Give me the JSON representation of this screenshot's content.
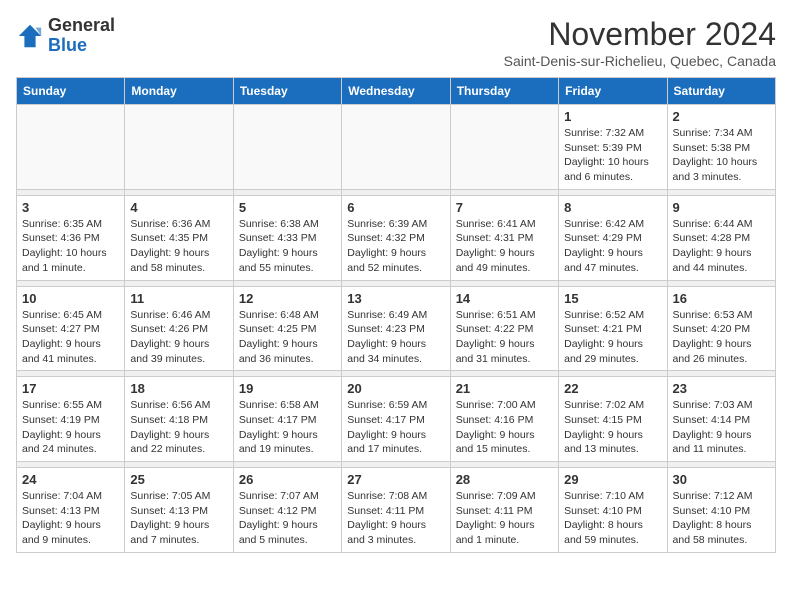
{
  "logo": {
    "general": "General",
    "blue": "Blue"
  },
  "header": {
    "month": "November 2024",
    "location": "Saint-Denis-sur-Richelieu, Quebec, Canada"
  },
  "weekdays": [
    "Sunday",
    "Monday",
    "Tuesday",
    "Wednesday",
    "Thursday",
    "Friday",
    "Saturday"
  ],
  "weeks": [
    [
      {
        "day": "",
        "info": ""
      },
      {
        "day": "",
        "info": ""
      },
      {
        "day": "",
        "info": ""
      },
      {
        "day": "",
        "info": ""
      },
      {
        "day": "",
        "info": ""
      },
      {
        "day": "1",
        "info": "Sunrise: 7:32 AM\nSunset: 5:39 PM\nDaylight: 10 hours and 6 minutes."
      },
      {
        "day": "2",
        "info": "Sunrise: 7:34 AM\nSunset: 5:38 PM\nDaylight: 10 hours and 3 minutes."
      }
    ],
    [
      {
        "day": "3",
        "info": "Sunrise: 6:35 AM\nSunset: 4:36 PM\nDaylight: 10 hours and 1 minute."
      },
      {
        "day": "4",
        "info": "Sunrise: 6:36 AM\nSunset: 4:35 PM\nDaylight: 9 hours and 58 minutes."
      },
      {
        "day": "5",
        "info": "Sunrise: 6:38 AM\nSunset: 4:33 PM\nDaylight: 9 hours and 55 minutes."
      },
      {
        "day": "6",
        "info": "Sunrise: 6:39 AM\nSunset: 4:32 PM\nDaylight: 9 hours and 52 minutes."
      },
      {
        "day": "7",
        "info": "Sunrise: 6:41 AM\nSunset: 4:31 PM\nDaylight: 9 hours and 49 minutes."
      },
      {
        "day": "8",
        "info": "Sunrise: 6:42 AM\nSunset: 4:29 PM\nDaylight: 9 hours and 47 minutes."
      },
      {
        "day": "9",
        "info": "Sunrise: 6:44 AM\nSunset: 4:28 PM\nDaylight: 9 hours and 44 minutes."
      }
    ],
    [
      {
        "day": "10",
        "info": "Sunrise: 6:45 AM\nSunset: 4:27 PM\nDaylight: 9 hours and 41 minutes."
      },
      {
        "day": "11",
        "info": "Sunrise: 6:46 AM\nSunset: 4:26 PM\nDaylight: 9 hours and 39 minutes."
      },
      {
        "day": "12",
        "info": "Sunrise: 6:48 AM\nSunset: 4:25 PM\nDaylight: 9 hours and 36 minutes."
      },
      {
        "day": "13",
        "info": "Sunrise: 6:49 AM\nSunset: 4:23 PM\nDaylight: 9 hours and 34 minutes."
      },
      {
        "day": "14",
        "info": "Sunrise: 6:51 AM\nSunset: 4:22 PM\nDaylight: 9 hours and 31 minutes."
      },
      {
        "day": "15",
        "info": "Sunrise: 6:52 AM\nSunset: 4:21 PM\nDaylight: 9 hours and 29 minutes."
      },
      {
        "day": "16",
        "info": "Sunrise: 6:53 AM\nSunset: 4:20 PM\nDaylight: 9 hours and 26 minutes."
      }
    ],
    [
      {
        "day": "17",
        "info": "Sunrise: 6:55 AM\nSunset: 4:19 PM\nDaylight: 9 hours and 24 minutes."
      },
      {
        "day": "18",
        "info": "Sunrise: 6:56 AM\nSunset: 4:18 PM\nDaylight: 9 hours and 22 minutes."
      },
      {
        "day": "19",
        "info": "Sunrise: 6:58 AM\nSunset: 4:17 PM\nDaylight: 9 hours and 19 minutes."
      },
      {
        "day": "20",
        "info": "Sunrise: 6:59 AM\nSunset: 4:17 PM\nDaylight: 9 hours and 17 minutes."
      },
      {
        "day": "21",
        "info": "Sunrise: 7:00 AM\nSunset: 4:16 PM\nDaylight: 9 hours and 15 minutes."
      },
      {
        "day": "22",
        "info": "Sunrise: 7:02 AM\nSunset: 4:15 PM\nDaylight: 9 hours and 13 minutes."
      },
      {
        "day": "23",
        "info": "Sunrise: 7:03 AM\nSunset: 4:14 PM\nDaylight: 9 hours and 11 minutes."
      }
    ],
    [
      {
        "day": "24",
        "info": "Sunrise: 7:04 AM\nSunset: 4:13 PM\nDaylight: 9 hours and 9 minutes."
      },
      {
        "day": "25",
        "info": "Sunrise: 7:05 AM\nSunset: 4:13 PM\nDaylight: 9 hours and 7 minutes."
      },
      {
        "day": "26",
        "info": "Sunrise: 7:07 AM\nSunset: 4:12 PM\nDaylight: 9 hours and 5 minutes."
      },
      {
        "day": "27",
        "info": "Sunrise: 7:08 AM\nSunset: 4:11 PM\nDaylight: 9 hours and 3 minutes."
      },
      {
        "day": "28",
        "info": "Sunrise: 7:09 AM\nSunset: 4:11 PM\nDaylight: 9 hours and 1 minute."
      },
      {
        "day": "29",
        "info": "Sunrise: 7:10 AM\nSunset: 4:10 PM\nDaylight: 8 hours and 59 minutes."
      },
      {
        "day": "30",
        "info": "Sunrise: 7:12 AM\nSunset: 4:10 PM\nDaylight: 8 hours and 58 minutes."
      }
    ]
  ]
}
